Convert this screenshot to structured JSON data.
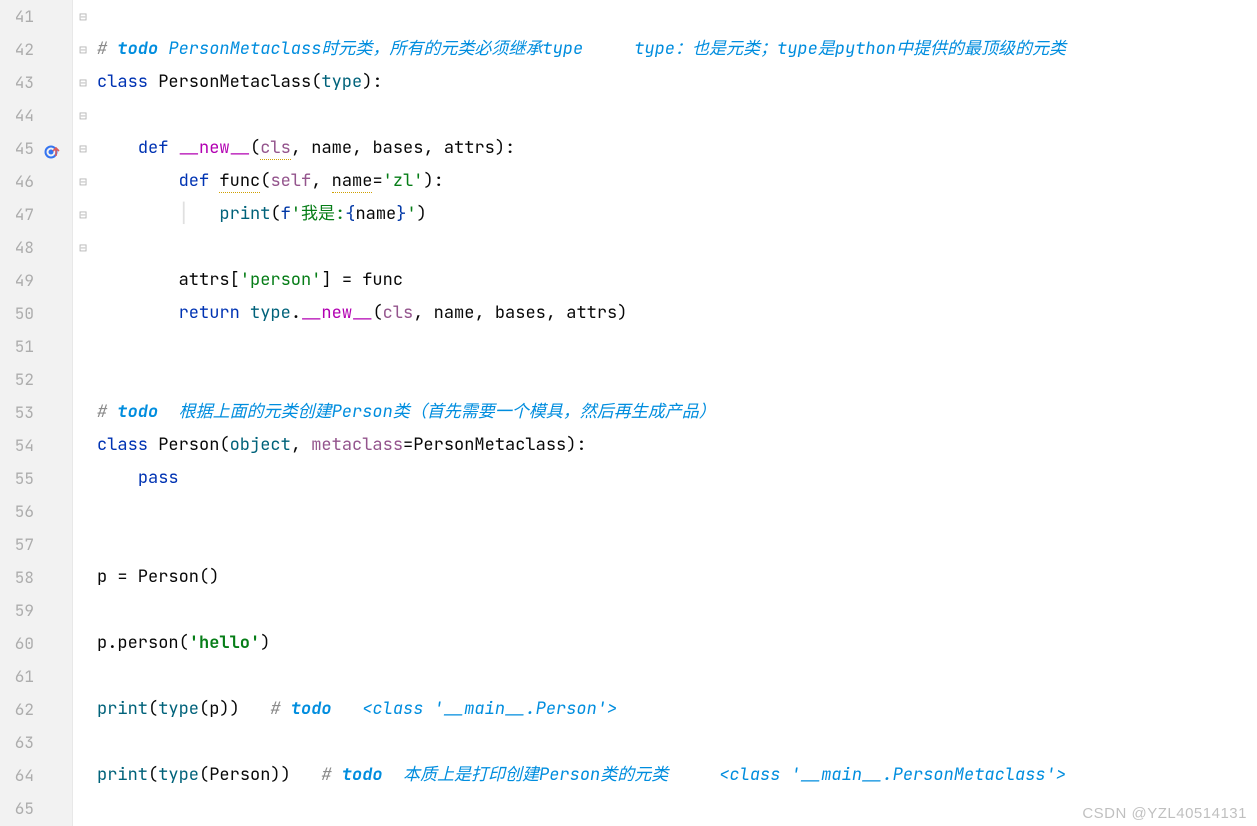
{
  "gutter": {
    "start": 41,
    "end": 65
  },
  "foldMarkers": {
    "42": "⊟",
    "43": "⊟",
    "45": "⊟",
    "46": "⊟",
    "47": "⊟",
    "49": "",
    "50": "⊟",
    "54": "⊟",
    "55": "⊟"
  },
  "breakpoint": {
    "line": 45
  },
  "code": {
    "l42_comment_hash": "# ",
    "l42_todo": "todo ",
    "l42_rest": "PersonMetaclass时元类，所有的元类必须继承type     type：也是元类；type是python中提供的最顶级的元类",
    "l43_class_kw": "class ",
    "l43_name": "PersonMetaclass",
    "l43_open": "(",
    "l43_type": "type",
    "l43_close": "):",
    "l45_def": "def ",
    "l45_dunder": "__new__",
    "l45_open": "(",
    "l45_cls": "cls",
    "l45_rest": ", name, bases, attrs):",
    "l46_def": "def ",
    "l46_fn": "func",
    "l46_open": "(",
    "l46_self": "self",
    "l46_mid": ", ",
    "l46_name": "name",
    "l46_eq": "=",
    "l46_str": "'zl'",
    "l46_close": "):",
    "l47_print": "print",
    "l47_open": "(",
    "l47_f": "f",
    "l47_strA": "'我是:",
    "l47_braceL": "{",
    "l47_nm": "name",
    "l47_braceR": "}",
    "l47_strB": "'",
    "l47_close": ")",
    "l49_a": "attrs[",
    "l49_key": "'person'",
    "l49_b": "] = func",
    "l50_ret": "return ",
    "l50_type": "type",
    "l50_dot": ".",
    "l50_dunder": "__new__",
    "l50_open": "(",
    "l50_cls": "cls",
    "l50_rest": ", name, bases, attrs)",
    "l53_hash": "# ",
    "l53_todo": "todo  ",
    "l53_rest": "根据上面的元类创建Person类（首先需要一个模具，然后再生成产品）",
    "l54_class": "class ",
    "l54_name": "Person",
    "l54_open": "(",
    "l54_obj": "object",
    "l54_comma": ", ",
    "l54_meta": "metaclass",
    "l54_eq": "=PersonMetaclass):",
    "l55_pass": "pass",
    "l58": "p = Person()",
    "l60_a": "p.person(",
    "l60_str": "'hello'",
    "l60_b": ")",
    "l62_print": "print",
    "l62_a": "(",
    "l62_type": "type",
    "l62_b": "(p))   ",
    "l62_hash": "# ",
    "l62_todo": "todo   ",
    "l62_rest": "<class '__main__.Person'>",
    "l64_print": "print",
    "l64_a": "(",
    "l64_type": "type",
    "l64_b": "(Person))   ",
    "l64_hash": "# ",
    "l64_todo": "todo  ",
    "l64_rest": "本质上是打印创建Person类的元类     <class '__main__.PersonMetaclass'>"
  },
  "watermark": "CSDN @YZL40514131"
}
